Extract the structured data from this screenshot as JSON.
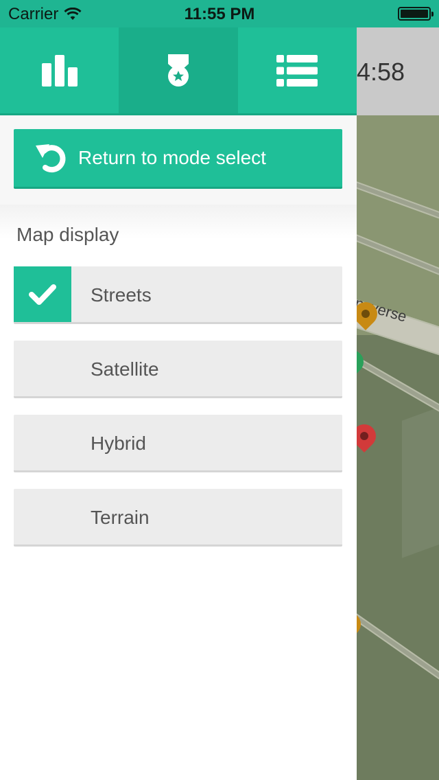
{
  "status_bar": {
    "carrier": "Carrier",
    "time": "11:55 PM"
  },
  "map": {
    "clock_text": "4:58",
    "street_label": "ansverse"
  },
  "tabs": [
    {
      "name": "stats",
      "icon": "bar-chart-icon"
    },
    {
      "name": "medal",
      "icon": "medal-icon",
      "active": true
    },
    {
      "name": "list",
      "icon": "list-icon"
    }
  ],
  "return_button": {
    "label": "Return to mode select",
    "icon": "return-arrow-icon"
  },
  "map_display": {
    "title": "Map display",
    "options": [
      {
        "label": "Streets",
        "selected": true
      },
      {
        "label": "Satellite",
        "selected": false
      },
      {
        "label": "Hybrid",
        "selected": false
      },
      {
        "label": "Terrain",
        "selected": false
      }
    ]
  },
  "colors": {
    "accent": "#1fbf98",
    "accent_dark": "#17a783",
    "option_bg": "#ececec",
    "text": "#555555"
  }
}
